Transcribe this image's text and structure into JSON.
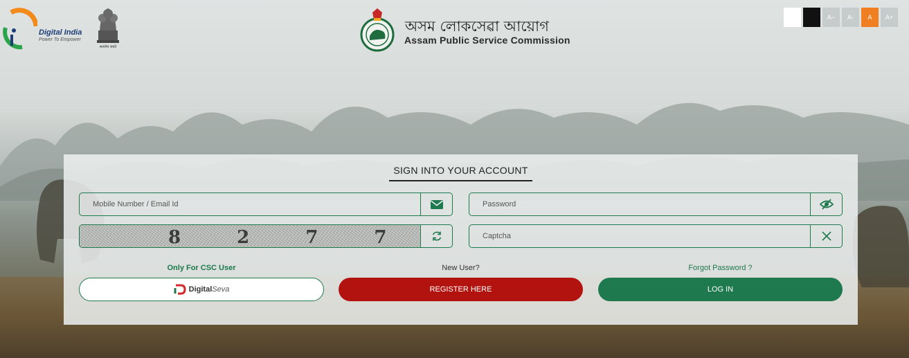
{
  "header": {
    "digital_india_title": "Digital India",
    "digital_india_tagline": "Power To Empower",
    "emblem_caption": "सत्यमेव जयते",
    "commission_name_bn": "অসম লোকসেৱা আয়োগ",
    "commission_name_en": "Assam Public Service Commission"
  },
  "accessibility": {
    "decrease_font_label": "A−",
    "normal_font_label": "A-",
    "default_font_label": "A",
    "increase_font_label": "A+",
    "white_theme_color": "#ffffff",
    "black_theme_color": "#111111",
    "active_color": "#f07f24"
  },
  "login": {
    "title": "SIGN INTO YOUR ACCOUNT",
    "mobile_placeholder": "Mobile Number / Email Id",
    "password_placeholder": "Password",
    "captcha_value": "8 2 7 7",
    "captcha_placeholder": "Captcha",
    "csc_label": "Only For CSC User",
    "csc_button_brand": "Digital",
    "csc_button_brand_italic": "Seva",
    "new_user_label": "New User?",
    "register_button": "REGISTER HERE",
    "forgot_password_label": "Forgot Password ?",
    "login_button": "LOG IN"
  },
  "icons": {
    "mobile_addon": "envelope-icon",
    "password_addon": "eye-slash-icon",
    "captcha_refresh": "refresh-icon",
    "captcha_clear": "close-icon"
  },
  "colors": {
    "primary_green": "#1e7a4e",
    "register_red": "#b3130f"
  }
}
